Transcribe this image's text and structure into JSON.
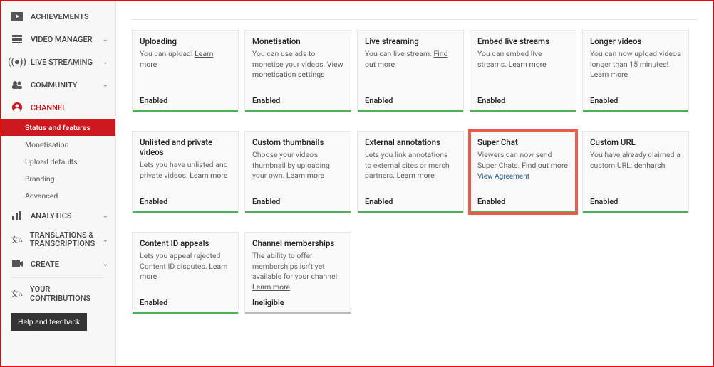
{
  "sidebar": {
    "achievements": "ACHIEVEMENTS",
    "video_manager": "VIDEO MANAGER",
    "live_streaming": "LIVE STREAMING",
    "community": "COMMUNITY",
    "channel": "CHANNEL",
    "channel_sub": {
      "status": "Status and features",
      "monetisation": "Monetisation",
      "upload_defaults": "Upload defaults",
      "branding": "Branding",
      "advanced": "Advanced"
    },
    "analytics": "ANALYTICS",
    "translations": "TRANSLATIONS & TRANSCRIPTIONS",
    "create": "CREATE",
    "contributions": "YOUR CONTRIBUTIONS",
    "help": "Help and feedback"
  },
  "links": {
    "learn_more": "Learn more",
    "find_out_more": "Find out more",
    "view_settings": "View monetisation settings",
    "view_agreement": "View Agreement"
  },
  "status": {
    "enabled": "Enabled",
    "ineligible": "Ineligible"
  },
  "cards": {
    "uploading": {
      "title": "Uploading",
      "desc": "You can upload! "
    },
    "monetisation": {
      "title": "Monetisation",
      "desc": "You can use ads to monetise your videos. "
    },
    "live_streaming": {
      "title": "Live streaming",
      "desc": "You can live stream. "
    },
    "embed": {
      "title": "Embed live streams",
      "desc": "You can embed live streams. "
    },
    "longer": {
      "title": "Longer videos",
      "desc": "You can now upload videos longer than 15 minutes! "
    },
    "unlisted": {
      "title": "Unlisted and private videos",
      "desc": "Lets you have unlisted and private videos. "
    },
    "thumbnails": {
      "title": "Custom thumbnails",
      "desc": "Choose your video's thumbnail by uploading your own. "
    },
    "external": {
      "title": "External annotations",
      "desc": "Lets you link annotations to external sites or merch partners. "
    },
    "superchat": {
      "title": "Super Chat",
      "desc": "Viewers can now send Super Chats. "
    },
    "customurl": {
      "title": "Custom URL",
      "desc": "You have already claimed a custom URL: ",
      "url": "denharsh"
    },
    "contentid": {
      "title": "Content ID appeals",
      "desc": "Lets you appeal rejected Content ID disputes. "
    },
    "memberships": {
      "title": "Channel memberships",
      "desc": "The ability to offer memberships isn't yet available for your channel. "
    }
  }
}
